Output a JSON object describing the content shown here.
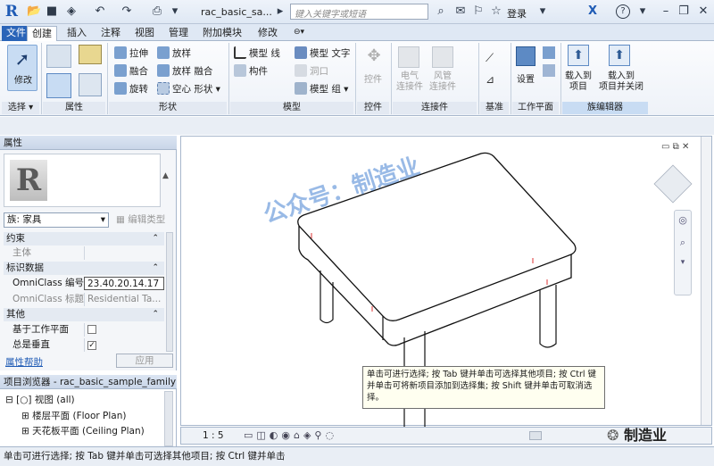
{
  "titlebar": {
    "app_logo": "R",
    "doc_title": "rac_basic_sa...",
    "search_placeholder": "键入关键字或短语",
    "login": "登录",
    "help": "?"
  },
  "tabs": [
    "文件",
    "创建",
    "插入",
    "注释",
    "视图",
    "管理",
    "附加模块",
    "修改"
  ],
  "ribbon": {
    "modify": "修改",
    "select_panel": "选择",
    "properties_panel": "属性",
    "form_panel": "形状",
    "form_items": [
      "拉伸",
      "融合",
      "旋转",
      "放样",
      "放样 融合",
      "空心 形状"
    ],
    "model_panel": "模型",
    "model_items": [
      "模型 线",
      "构件",
      "模型 文字",
      "洞口",
      "模型 组"
    ],
    "control_panel": "控件",
    "control_label": "控件",
    "connectors_panel": "连接件",
    "connector_items": [
      "电气\n连接件",
      "风管\n连接件"
    ],
    "datum_panel": "基准",
    "workplane_panel": "工作平面",
    "workplane_set": "设置",
    "family_editor_panel": "族编辑器",
    "load_into_project": "载入到\n项目",
    "load_and_close": "载入到\n项目并关闭"
  },
  "properties": {
    "header": "属性",
    "type_selector": "族: 家具",
    "edit_type": "编辑类型",
    "groups": {
      "constraints": "约束",
      "identity": "标识数据",
      "other": "其他"
    },
    "rows": [
      {
        "k": "主体",
        "v": ""
      },
      {
        "k": "OmniClass 编号",
        "v": "23.40.20.14.17"
      },
      {
        "k": "OmniClass 标题",
        "v": "Residential Ta..."
      },
      {
        "k": "基于工作平面",
        "v": ""
      },
      {
        "k": "总是垂直",
        "v": ""
      }
    ],
    "help_link": "属性帮助",
    "apply": "应用"
  },
  "browser": {
    "header": "项目浏览器 - rac_basic_sample_family",
    "items": [
      "视图 (all)",
      "楼层平面 (Floor Plan)",
      "天花板平面 (Ceiling Plan)"
    ]
  },
  "view_control": {
    "scale": "1 : 5"
  },
  "tooltip": "单击可进行选择; 按 Tab 键并单击可选择其他项目; 按 Ctrl 键并单击可将新项目添加到选择集; 按 Shift 键并单击可取消选择。",
  "statusbar": "单击可进行选择; 按 Tab 键并单击可选择其他项目; 按 Ctrl 键并单击",
  "watermark": "公众号：制造业",
  "brand_badge": "制造业"
}
